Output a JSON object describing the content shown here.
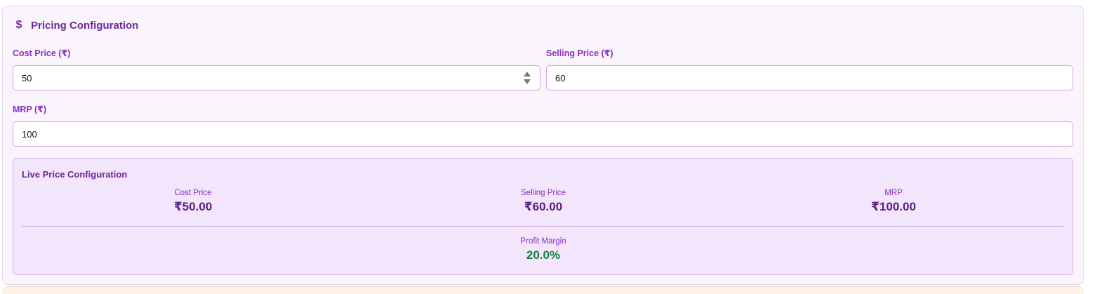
{
  "section": {
    "icon": "dollar-icon",
    "title": "Pricing Configuration"
  },
  "fields": {
    "cost_price": {
      "label": "Cost Price (₹)",
      "value": "50"
    },
    "selling_price": {
      "label": "Selling Price (₹)",
      "value": "60"
    },
    "mrp": {
      "label": "MRP (₹)",
      "value": "100"
    }
  },
  "live": {
    "title": "Live Price Configuration",
    "cost_label": "Cost Price",
    "cost_value": "₹50.00",
    "selling_label": "Selling Price",
    "selling_value": "₹60.00",
    "mrp_label": "MRP",
    "mrp_value": "₹100.00",
    "margin_label": "Profit Margin",
    "margin_value": "20.0%"
  },
  "colors": {
    "accent": "#7b2fa3",
    "label": "#8a2fc0",
    "card_bg": "#faf4fd",
    "live_bg": "#f3e5fb",
    "margin_positive": "#15803d"
  }
}
